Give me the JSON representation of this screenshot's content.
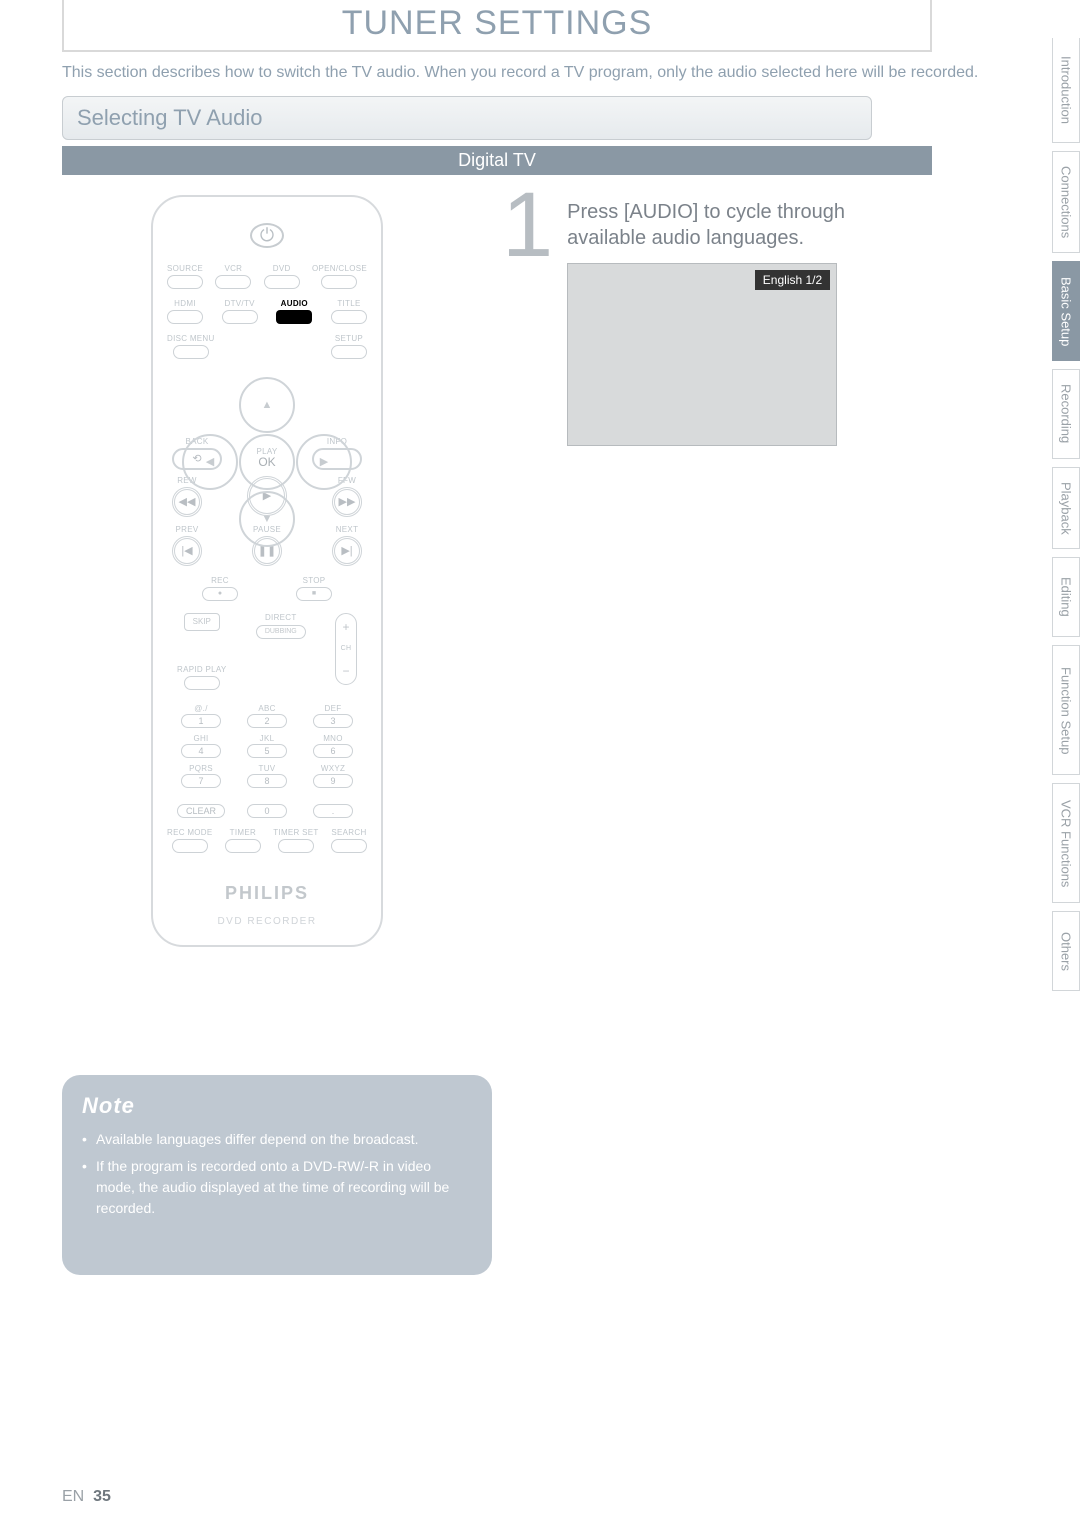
{
  "title": "TUNER SETTINGS",
  "intro": "This section describes how to switch the TV audio. When you record a TV program, only the audio selected here will be recorded.",
  "section_heading": "Selecting TV Audio",
  "band": "Digital TV",
  "tabs": {
    "items": [
      "Introduction",
      "Connections",
      "Basic Setup",
      "Recording",
      "Playback",
      "Editing",
      "Function Setup",
      "VCR Functions",
      "Others"
    ],
    "active_index": 2
  },
  "step": {
    "number": "1",
    "text": "Press [AUDIO] to cycle through available audio languages.",
    "overlay": "English 1/2"
  },
  "note": {
    "title": "Note",
    "items": [
      "Available languages differ depend on the broadcast.",
      "If the program is recorded onto a DVD-RW/-R in video mode, the audio displayed at the time of recording will be recorded."
    ]
  },
  "page_number": {
    "en": "EN",
    "num": "35"
  },
  "remote": {
    "row1": {
      "a": "SOURCE",
      "b": "VCR",
      "c": "DVD",
      "d": "OPEN/CLOSE"
    },
    "row2": {
      "a": "HDMI",
      "b": "DTV/TV",
      "c": "AUDIO",
      "d": "TITLE"
    },
    "row3": {
      "a": "DISC MENU",
      "b": "SETUP"
    },
    "ok": "OK",
    "back": "BACK",
    "info": "INFO",
    "play": "PLAY",
    "rew": "REW",
    "ffw": "FFW",
    "prev": "PREV",
    "pause": "PAUSE",
    "next": "NEXT",
    "rec": "REC",
    "stop": "STOP",
    "skip": "SKIP",
    "direct": "DIRECT",
    "dubbing": "DUBBING",
    "ch": "CH",
    "rapid": "RAPID PLAY",
    "digit_labels": [
      "@./",
      "ABC",
      "DEF",
      "GHI",
      "JKL",
      "MNO",
      "PQRS",
      "TUV",
      "WXYZ",
      "",
      "",
      ""
    ],
    "digits": [
      "1",
      "2",
      "3",
      "4",
      "5",
      "6",
      "7",
      "8",
      "9",
      "CLEAR",
      "0",
      "."
    ],
    "bottom_row": [
      "REC MODE",
      "TIMER",
      "TIMER SET",
      "SEARCH"
    ],
    "brand": "PHILIPS",
    "sub_brand": "DVD RECORDER"
  }
}
